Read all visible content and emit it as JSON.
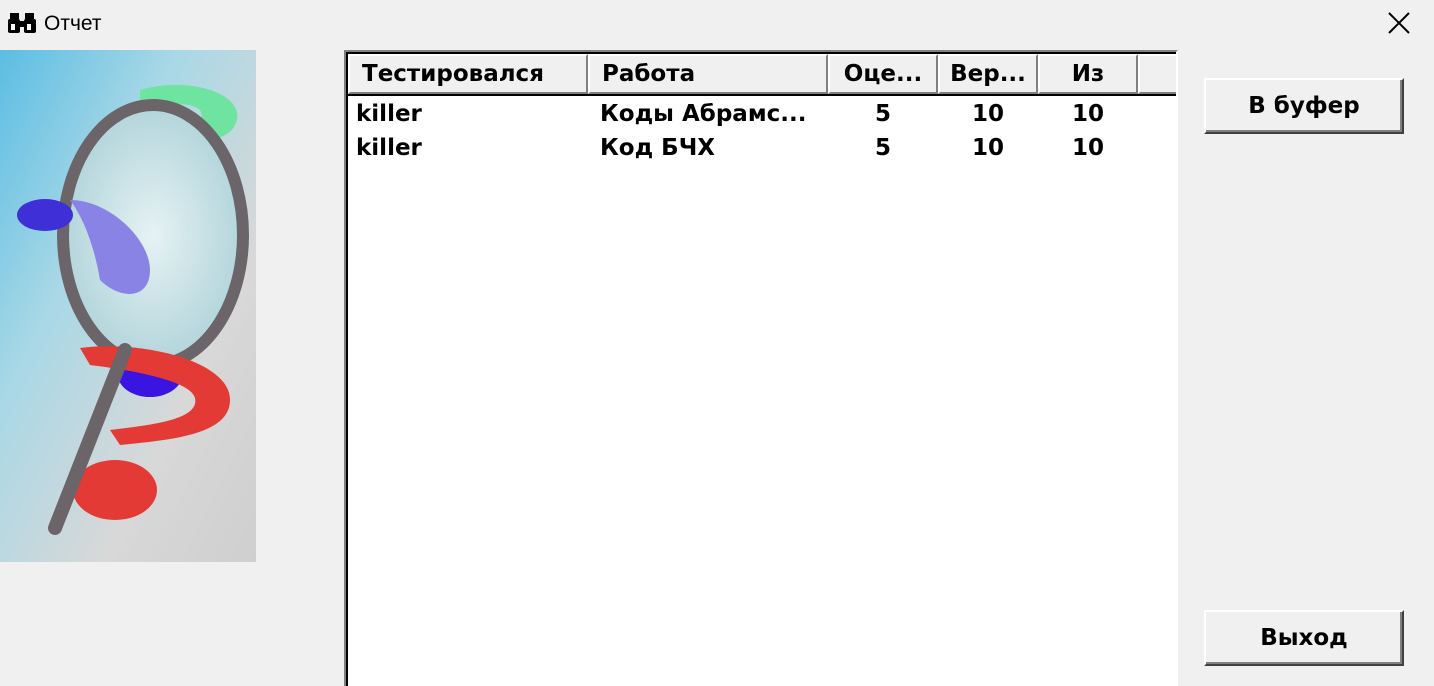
{
  "window": {
    "title": "Отчет",
    "icon": "binoculars-icon",
    "close_label": "close-icon"
  },
  "table": {
    "columns": [
      "Тестировался",
      "Работа",
      "Оце...",
      "Вер...",
      "Из",
      ""
    ],
    "rows": [
      [
        "killer",
        "Коды Абрамс...",
        "5",
        "10",
        "10"
      ],
      [
        "killer",
        "Код БЧХ",
        "5",
        "10",
        "10"
      ]
    ]
  },
  "buttons": {
    "copy_label": "В буфер",
    "exit_label": "Выход"
  },
  "colors": {
    "window_bg": "#f0f0f0",
    "grid_bg": "#ffffff"
  }
}
